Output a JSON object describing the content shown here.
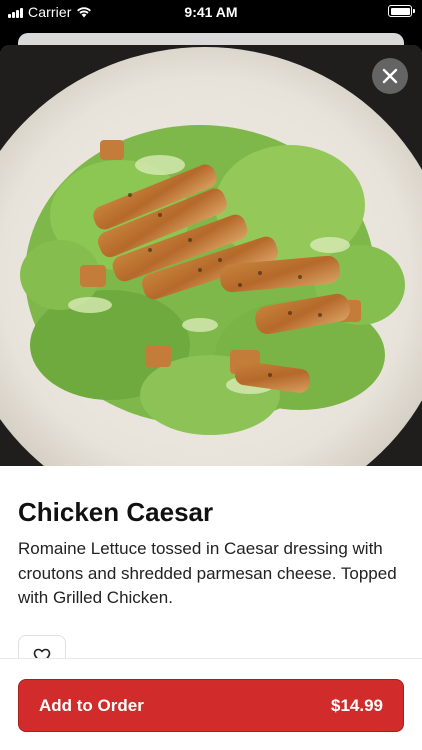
{
  "status_bar": {
    "carrier": "Carrier",
    "time": "9:41 AM",
    "battery_level": 1.0
  },
  "item": {
    "title": "Chicken Caesar",
    "description": "Romaine Lettuce tossed in Caesar dressing with croutons and shredded parmesan cheese. Topped with Grilled Chicken.",
    "price": "$14.99",
    "image_icon": "salad-photo"
  },
  "actions": {
    "add_to_order_label": "Add to Order",
    "close_icon": "close-icon",
    "favorite_icon": "heart-outline-icon"
  },
  "colors": {
    "accent": "#d12b2b",
    "accent_border": "#a81e1e",
    "status_bar_bg": "#000000"
  }
}
